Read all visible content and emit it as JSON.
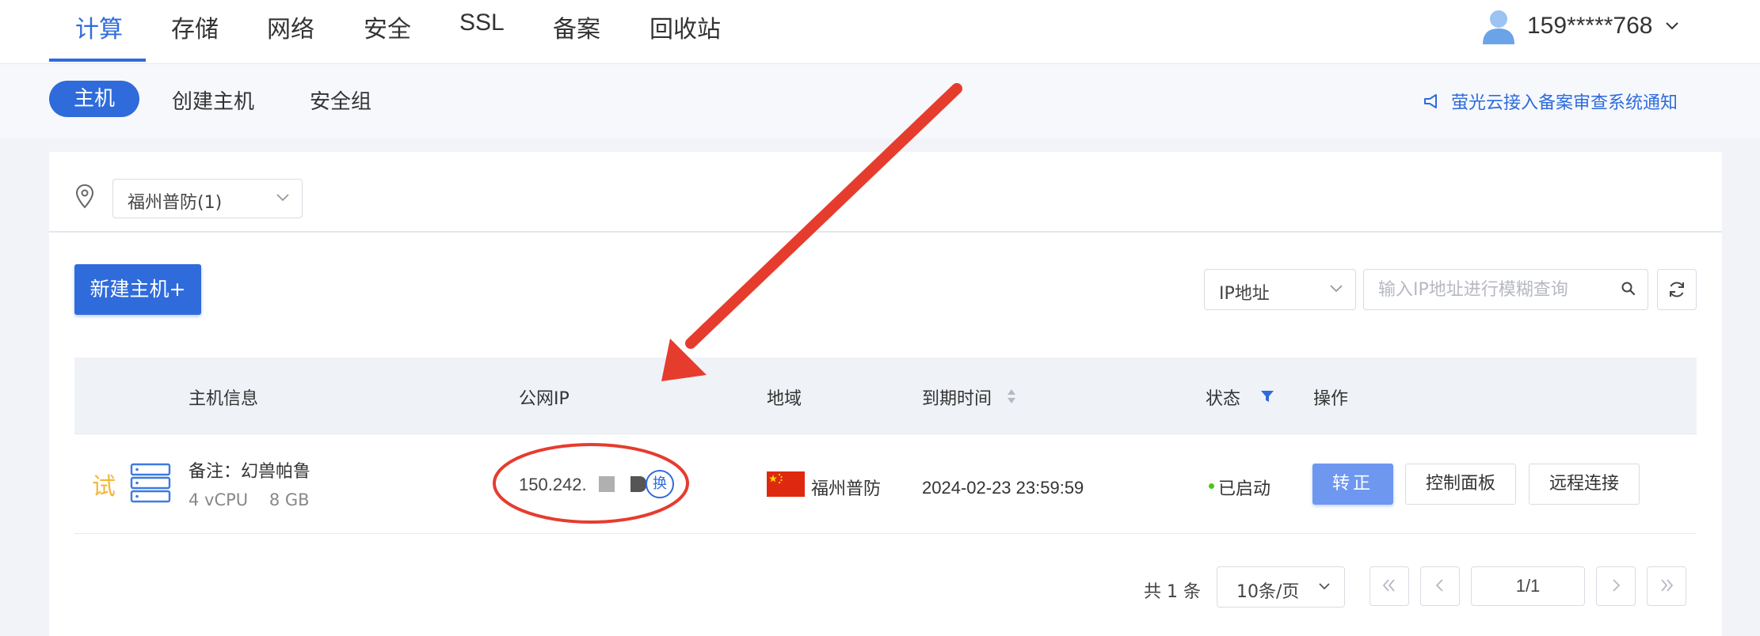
{
  "topnav": {
    "tabs": [
      {
        "label": "计算",
        "active": true
      },
      {
        "label": "存储"
      },
      {
        "label": "网络"
      },
      {
        "label": "安全"
      },
      {
        "label": "SSL"
      },
      {
        "label": "备案"
      },
      {
        "label": "回收站"
      }
    ],
    "user": {
      "phone": "159*****768",
      "icon": "user-avatar-icon"
    }
  },
  "subnav": {
    "tabs": [
      {
        "label": "主机",
        "active": true
      },
      {
        "label": "创建主机"
      },
      {
        "label": "安全组"
      }
    ],
    "notice": {
      "icon": "megaphone-icon",
      "text": "萤光云接入备案审查系统通知"
    }
  },
  "region": {
    "icon": "location-pin-icon",
    "selected": "福州普防(1)"
  },
  "toolbar": {
    "new_button": "新建主机+",
    "search_field": {
      "selected": "IP地址",
      "placeholder": "输入IP地址进行模糊查询"
    },
    "refresh_icon": "refresh-icon"
  },
  "table": {
    "columns": [
      "主机信息",
      "公网IP",
      "地域",
      "到期时间",
      "状态",
      "操作"
    ],
    "rows": [
      {
        "trial_badge": "试",
        "remark": "备注：幻兽帕鲁",
        "spec": "4 vCPU    8 GB",
        "ip": "150.242.",
        "swap_label": "换",
        "region": "福州普防",
        "expire": "2024-02-23 23:59:59",
        "status": "已启动",
        "actions": {
          "convert": "转正",
          "panel": "控制面板",
          "remote": "远程连接"
        }
      }
    ]
  },
  "pagination": {
    "total": "共 1 条",
    "page_size": "10条/页",
    "page": "1/1"
  },
  "colors": {
    "accent": "#2f6bdb",
    "trial": "#f3b63a",
    "status_running": "#52c41a",
    "annotation": "#e63c2e"
  }
}
